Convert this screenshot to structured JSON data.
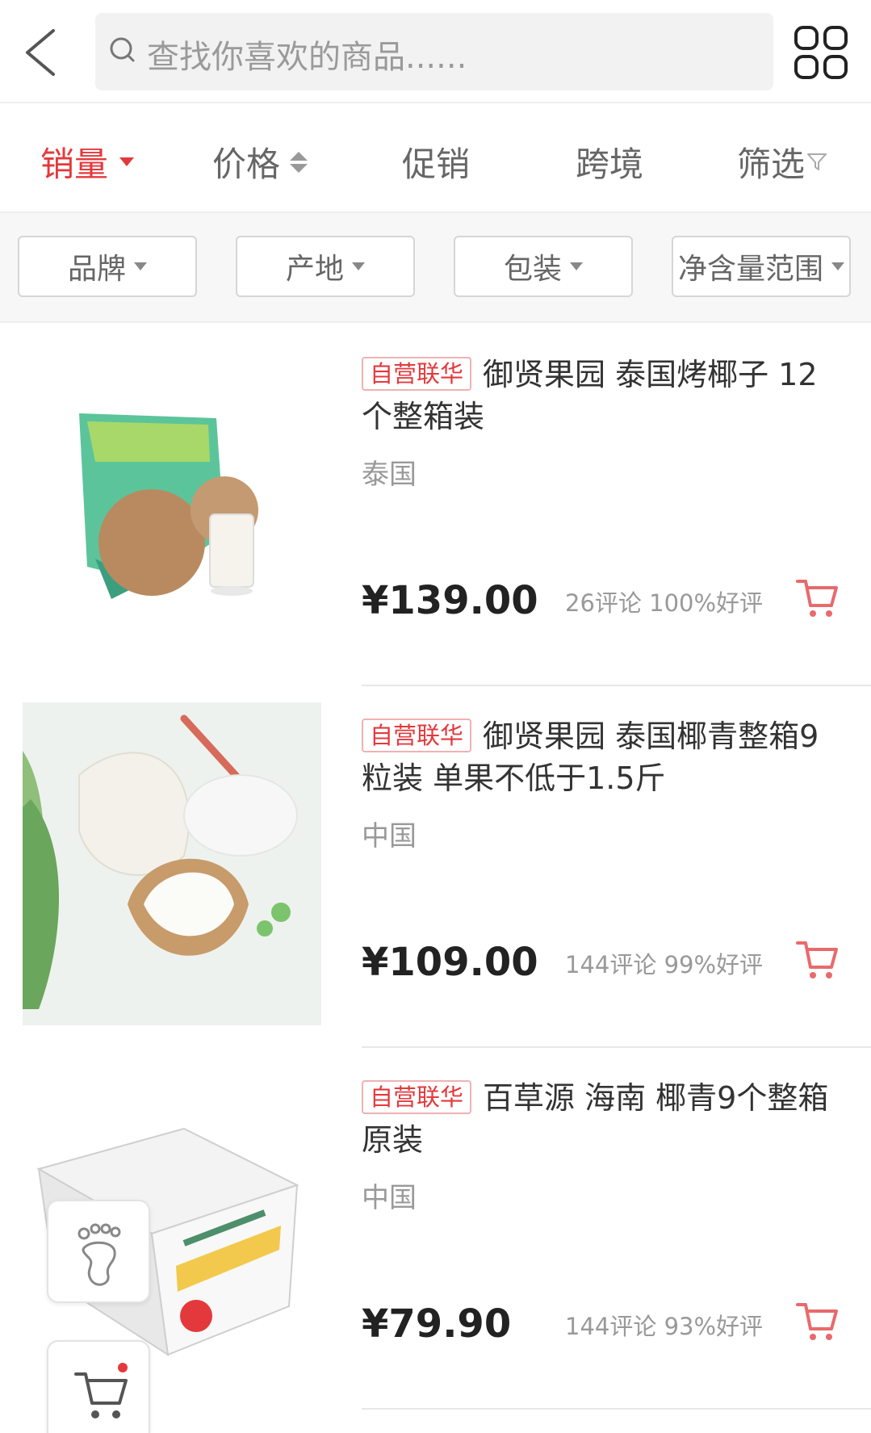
{
  "search": {
    "placeholder": "查找你喜欢的商品......"
  },
  "sort_tabs": [
    {
      "label": "销量",
      "active": true
    },
    {
      "label": "价格"
    },
    {
      "label": "促销"
    },
    {
      "label": "跨境"
    },
    {
      "label": "筛选"
    }
  ],
  "filters": [
    {
      "label": "品牌"
    },
    {
      "label": "产地"
    },
    {
      "label": "包装"
    },
    {
      "label": "净含量范围"
    }
  ],
  "products": [
    {
      "tag": "自营联华",
      "name": "御贤果园 泰国烤椰子 12个整箱装",
      "origin": "泰国",
      "price": "¥139.00",
      "stats": "26评论 100%好评"
    },
    {
      "tag": "自营联华",
      "name": "御贤果园 泰国椰青整箱9粒装 单果不低于1.5斤",
      "origin": "中国",
      "price": "¥109.00",
      "stats": "144评论 99%好评"
    },
    {
      "tag": "自营联华",
      "name": "百草源 海南 椰青9个整箱原装",
      "origin": "中国",
      "price": "¥79.90",
      "stats": "144评论 93%好评"
    }
  ],
  "colors": {
    "accent": "#e4393c",
    "muted": "#999999"
  },
  "icons": [
    "back-arrow-icon",
    "search-icon",
    "grid-icon",
    "sort-arrow-icon",
    "filter-funnel-icon",
    "cart-icon",
    "footprint-icon"
  ]
}
